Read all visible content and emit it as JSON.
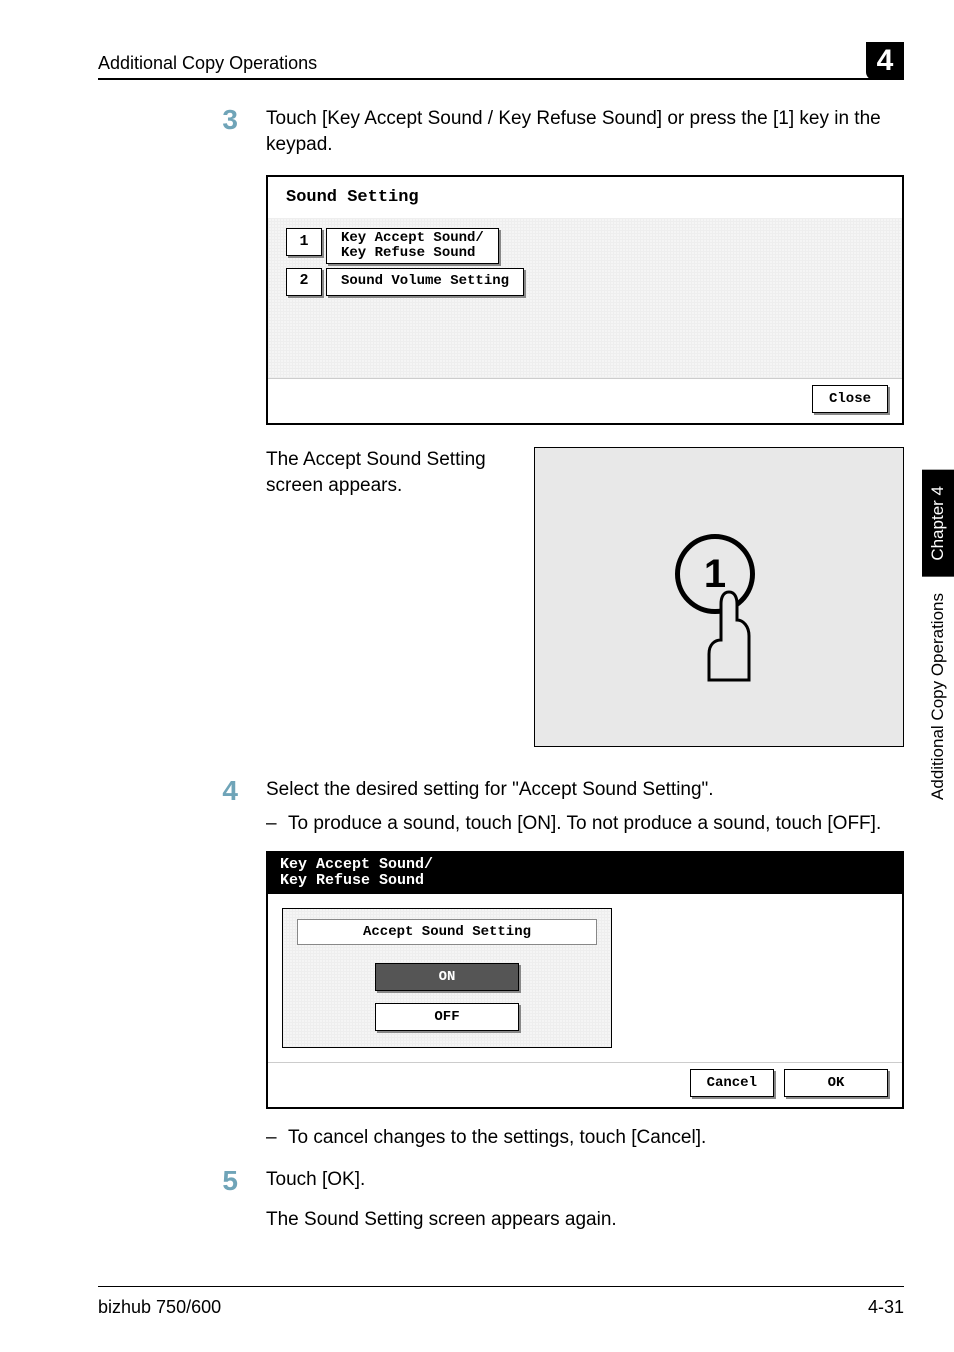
{
  "header": {
    "running_head": "Additional Copy Operations",
    "chapter_badge": "4"
  },
  "sidetab": {
    "black": "Chapter 4",
    "white": "Additional Copy Operations"
  },
  "steps": {
    "s3": {
      "num": "3",
      "text": "Touch [Key Accept Sound / Key Refuse Sound] or press the [1] key in the keypad."
    },
    "s4": {
      "num": "4",
      "text": "Select the desired setting for \"Accept Sound Setting\".",
      "dash1": "To produce a sound, touch [ON]. To not produce a sound, touch [OFF].",
      "dash2": "To cancel changes to the settings, touch [Cancel]."
    },
    "s5": {
      "num": "5",
      "text1": "Touch [OK].",
      "text2": "The Sound Setting screen appears again."
    }
  },
  "caption_after_screen1": "The Accept Sound Setting screen appears.",
  "screen1": {
    "title": "Sound Setting",
    "row1_num": "1",
    "row1_label": "Key Accept Sound/\nKey Refuse Sound",
    "row2_num": "2",
    "row2_label": "Sound Volume Setting",
    "close": "Close"
  },
  "keypad_digit": "1",
  "screen2": {
    "header": "Key Accept Sound/\nKey Refuse Sound",
    "panel_title": "Accept Sound Setting",
    "on": "ON",
    "off": "OFF",
    "cancel": "Cancel",
    "ok": "OK"
  },
  "footer": {
    "left": "bizhub 750/600",
    "right": "4-31"
  }
}
